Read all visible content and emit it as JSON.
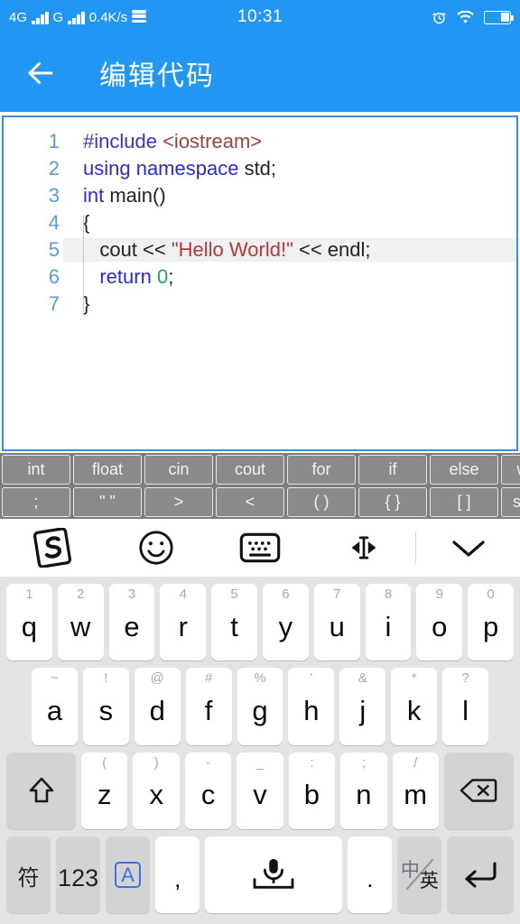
{
  "statusbar": {
    "network_label": "4G",
    "network_label2": "G",
    "speed": "0.4K/s",
    "data_icon": "data-stack-icon",
    "time": "10:31",
    "alarm_icon": "alarm-clock-icon",
    "wifi_icon": "wifi-icon",
    "battery_icon": "battery-icon",
    "battery_level_pct": 34,
    "background": "#2196f3"
  },
  "appbar": {
    "back_icon": "back-arrow-icon",
    "title": "编辑代码",
    "background": "#2196f3"
  },
  "editor": {
    "border_color": "#3d8ce0",
    "active_line": 5,
    "lines": [
      {
        "n": "1",
        "tokens": [
          {
            "t": "#include ",
            "c": "pp"
          },
          {
            "t": "<iostream>",
            "c": "inc"
          }
        ]
      },
      {
        "n": "2",
        "tokens": [
          {
            "t": "using namespace ",
            "c": "kw"
          },
          {
            "t": "std;",
            "c": "pl"
          }
        ]
      },
      {
        "n": "3",
        "tokens": [
          {
            "t": "int ",
            "c": "kw"
          },
          {
            "t": "main()",
            "c": "pl"
          }
        ]
      },
      {
        "n": "4",
        "tokens": [
          {
            "t": "{",
            "c": "pl"
          }
        ]
      },
      {
        "n": "5",
        "tokens": [
          {
            "t": "   cout << ",
            "c": "pl"
          },
          {
            "t": "\"Hello World!\"",
            "c": "str"
          },
          {
            "t": " << endl;",
            "c": "pl"
          }
        ]
      },
      {
        "n": "6",
        "tokens": [
          {
            "t": "   ",
            "c": "pl"
          },
          {
            "t": "return ",
            "c": "kw"
          },
          {
            "t": "0",
            "c": "num"
          },
          {
            "t": ";",
            "c": "pl"
          }
        ]
      },
      {
        "n": "7",
        "tokens": [
          {
            "t": "}",
            "c": "pl"
          }
        ]
      }
    ]
  },
  "code_toolbar": {
    "background": "#7d7d7d",
    "rows": [
      [
        "int",
        "float",
        "cin",
        "cout",
        "for",
        "if",
        "else",
        "while",
        "+",
        "*"
      ],
      [
        ";",
        "\" \"",
        ">",
        "<",
        "( )",
        "{ }",
        "[ ]",
        "switch",
        "-",
        "/"
      ]
    ]
  },
  "ime_toolbar": {
    "items": [
      {
        "name": "sogou-logo-icon",
        "label": "S"
      },
      {
        "name": "emoji-smiley-icon",
        "label": ""
      },
      {
        "name": "keyboard-switch-icon",
        "label": ""
      },
      {
        "name": "cursor-move-icon",
        "label": ""
      },
      {
        "name": "divider",
        "label": ""
      },
      {
        "name": "collapse-keyboard-chevron-down-icon",
        "label": ""
      }
    ]
  },
  "keyboard": {
    "background": "#e3e3e5",
    "row1": [
      {
        "main": "q",
        "sup": "1"
      },
      {
        "main": "w",
        "sup": "2"
      },
      {
        "main": "e",
        "sup": "3"
      },
      {
        "main": "r",
        "sup": "4"
      },
      {
        "main": "t",
        "sup": "5"
      },
      {
        "main": "y",
        "sup": "6"
      },
      {
        "main": "u",
        "sup": "7"
      },
      {
        "main": "i",
        "sup": "8"
      },
      {
        "main": "o",
        "sup": "9"
      },
      {
        "main": "p",
        "sup": "0"
      }
    ],
    "row2": [
      {
        "main": "a",
        "sup": "~"
      },
      {
        "main": "s",
        "sup": "!"
      },
      {
        "main": "d",
        "sup": "@"
      },
      {
        "main": "f",
        "sup": "#"
      },
      {
        "main": "g",
        "sup": "%"
      },
      {
        "main": "h",
        "sup": "'"
      },
      {
        "main": "j",
        "sup": "&"
      },
      {
        "main": "k",
        "sup": "*"
      },
      {
        "main": "l",
        "sup": "?"
      }
    ],
    "row3": [
      {
        "main": "z",
        "sup": "("
      },
      {
        "main": "x",
        "sup": ")"
      },
      {
        "main": "c",
        "sup": "-"
      },
      {
        "main": "v",
        "sup": "_"
      },
      {
        "main": "b",
        "sup": ":"
      },
      {
        "main": "n",
        "sup": ";"
      },
      {
        "main": "m",
        "sup": "/"
      }
    ],
    "shift_icon": "shift-up-arrow-icon",
    "backspace_icon": "backspace-delete-icon",
    "row4": {
      "symbol_key": "符",
      "number_key": "123",
      "abc_key": "A",
      "comma_key": ",",
      "space_icon": "microphone-space-icon",
      "period_key": ".",
      "lang_top": "中",
      "lang_bottom": "英",
      "enter_icon": "enter-return-icon"
    }
  }
}
